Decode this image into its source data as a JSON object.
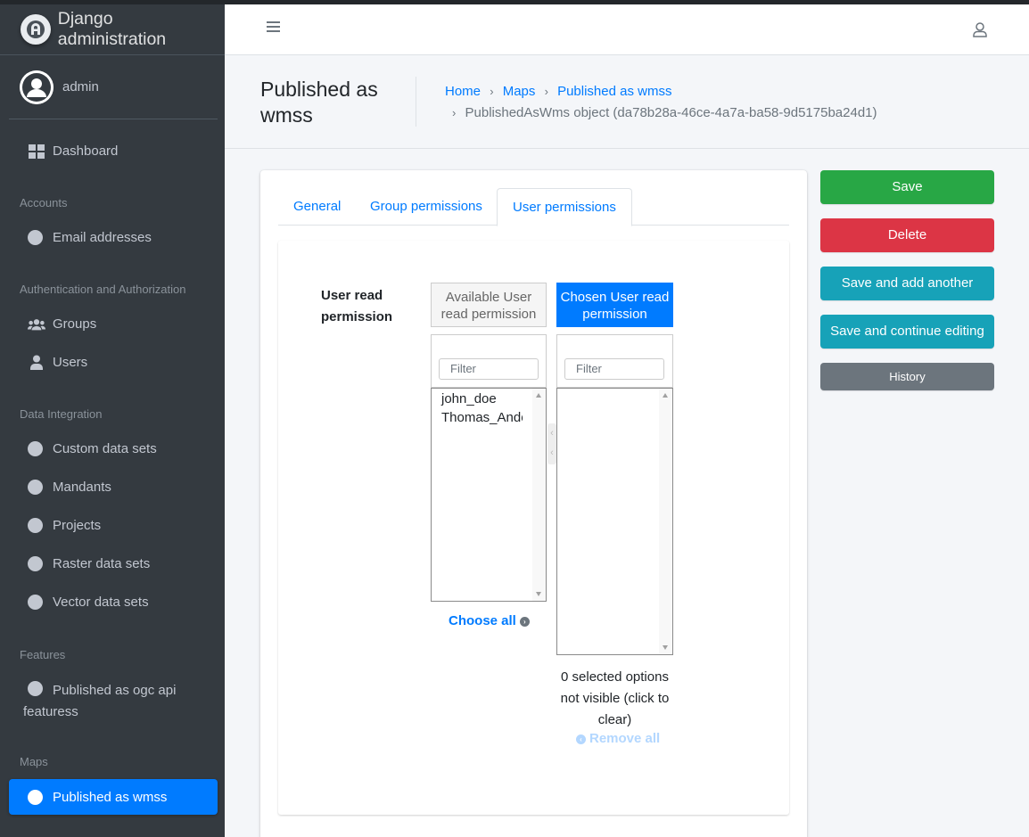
{
  "app": {
    "brand": "Django administration",
    "user": "admin"
  },
  "sidebar": {
    "dashboard": "Dashboard",
    "headers": {
      "accounts": "Accounts",
      "auth": "Authentication and Authorization",
      "data_integration": "Data Integration",
      "features": "Features",
      "maps": "Maps"
    },
    "items": {
      "email_addresses": "Email addresses",
      "groups": "Groups",
      "users": "Users",
      "custom_data_sets": "Custom data sets",
      "mandants": "Mandants",
      "projects": "Projects",
      "raster_data_sets": "Raster data sets",
      "vector_data_sets": "Vector data sets",
      "published_ogc_line1": "Published as ogc api",
      "published_ogc_line2": "featuress",
      "published_wmss": "Published as wmss"
    }
  },
  "header": {
    "page_title": "Published as wmss",
    "breadcrumb": {
      "home": "Home",
      "maps": "Maps",
      "published": "Published as wmss",
      "current": "PublishedAsWms object (da78b28a-46ce-4a7a-ba58-9d5175ba24d1)"
    }
  },
  "tabs": {
    "general": "General",
    "group_permissions": "Group permissions",
    "user_permissions": "User permissions"
  },
  "form": {
    "field_label": "User read permission",
    "available_title": "Available User read permission",
    "chosen_title": "Chosen User read permission",
    "filter_placeholder": "Filter",
    "available_options": [
      "john_doe",
      "Thomas_Anderson"
    ],
    "chosen_options": [],
    "choose_all": "Choose all",
    "remove_all": "Remove all",
    "selected_help": "0 selected options not visible (click to clear)"
  },
  "actions": {
    "save": "Save",
    "delete": "Delete",
    "save_add_another": "Save and add another",
    "save_continue": "Save and continue editing",
    "history": "History"
  },
  "colors": {
    "primary": "#007bff",
    "success": "#28a745",
    "danger": "#dc3545",
    "info": "#17a2b8",
    "secondary": "#6c757d",
    "sidebar": "#343a40"
  }
}
